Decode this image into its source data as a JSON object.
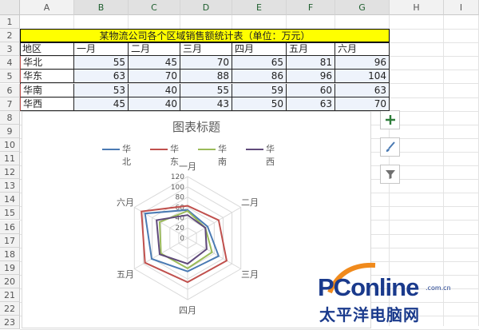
{
  "spreadsheet": {
    "columns": [
      "A",
      "B",
      "C",
      "D",
      "E",
      "F",
      "G",
      "H",
      "I"
    ],
    "selected_columns": [
      "B",
      "C",
      "D",
      "E",
      "F",
      "G"
    ],
    "rows": [
      "1",
      "2",
      "3",
      "4",
      "5",
      "6",
      "7",
      "8",
      "9",
      "10",
      "11",
      "12",
      "13",
      "14",
      "15",
      "16",
      "17",
      "18",
      "19",
      "20",
      "21",
      "22",
      "23"
    ],
    "title": "某物流公司各个区域销售额统计表（单位：万元）",
    "header_row": [
      "地区",
      "一月",
      "二月",
      "三月",
      "四月",
      "五月",
      "六月"
    ],
    "data_rows": [
      [
        "华北",
        "55",
        "45",
        "70",
        "65",
        "81",
        "96"
      ],
      [
        "华东",
        "63",
        "70",
        "88",
        "86",
        "96",
        "104"
      ],
      [
        "华南",
        "53",
        "40",
        "55",
        "59",
        "60",
        "63"
      ],
      [
        "华西",
        "45",
        "40",
        "43",
        "50",
        "63",
        "70"
      ]
    ]
  },
  "chart": {
    "add_element_icon": "plus-icon",
    "style_icon": "brush-icon",
    "filter_icon": "filter-icon"
  },
  "chart_data": {
    "type": "radar",
    "title": "图表标题",
    "categories": [
      "一月",
      "二月",
      "三月",
      "四月",
      "五月",
      "六月"
    ],
    "axis_ticks": [
      "0",
      "20",
      "40",
      "60",
      "80",
      "100",
      "120"
    ],
    "ylim": [
      0,
      120
    ],
    "legend_position": "top",
    "series": [
      {
        "name": "华北",
        "color": "#4a7ab3",
        "values": [
          55,
          45,
          70,
          65,
          81,
          96
        ]
      },
      {
        "name": "华东",
        "color": "#c0504d",
        "values": [
          63,
          70,
          88,
          86,
          96,
          104
        ]
      },
      {
        "name": "华南",
        "color": "#9bbb59",
        "values": [
          53,
          40,
          55,
          59,
          60,
          63
        ]
      },
      {
        "name": "华西",
        "color": "#604a7b",
        "values": [
          45,
          40,
          43,
          50,
          63,
          70
        ]
      }
    ]
  },
  "watermark": {
    "brand": "PConline",
    "domain": ".com.cn",
    "chinese": "太平洋电脑网"
  }
}
